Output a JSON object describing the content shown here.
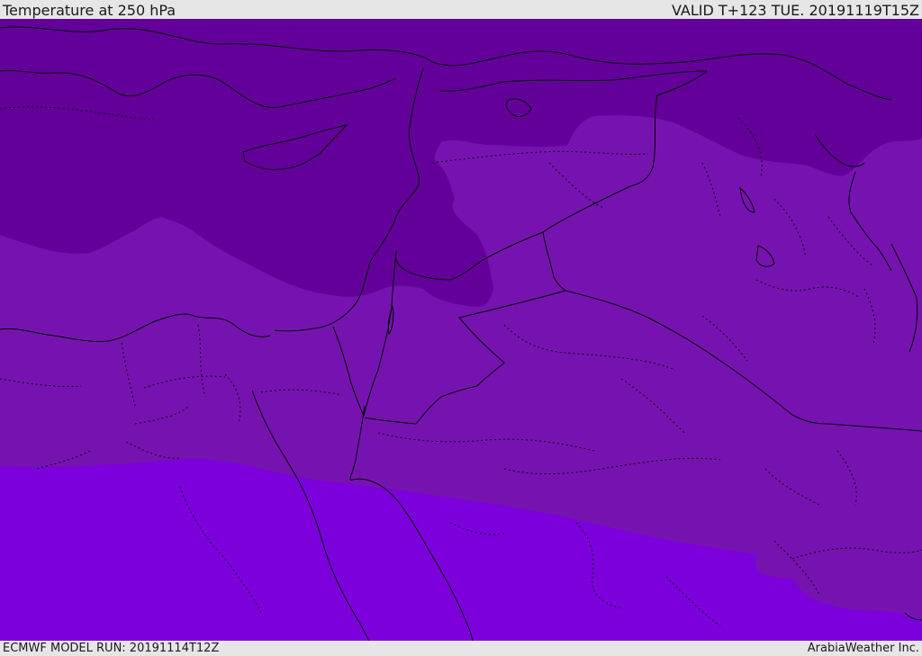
{
  "header": {
    "title": "Temperature at 250 hPa",
    "valid_time": "VALID T+123 TUE. 20191119T15Z"
  },
  "footer": {
    "model_run": "ECMWF MODEL RUN: 20191114T12Z",
    "credit": "ArabiaWeather Inc."
  },
  "map": {
    "field": "temperature-250hPa",
    "region": "Eastern Mediterranean / Middle East",
    "colors": {
      "band_coldest": "#63009a",
      "band_mid": "#7613b0",
      "band_warmest": "#7c00dc",
      "coastline": "#000000",
      "border": "#000000"
    }
  }
}
